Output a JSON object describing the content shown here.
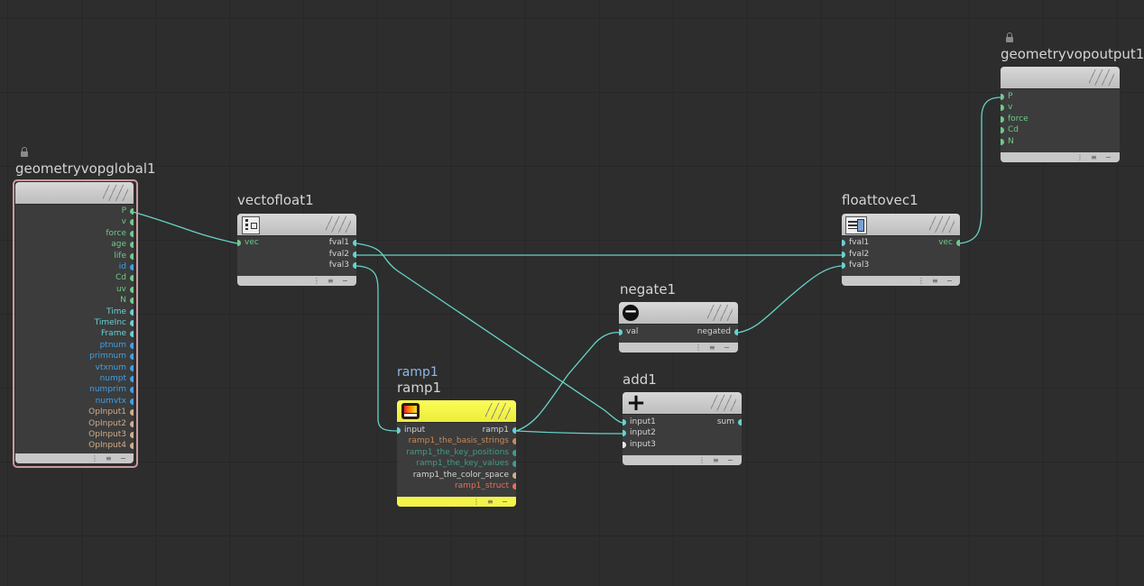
{
  "colors": {
    "background": "#2d2d2d",
    "wire": "#67d3c7",
    "port_green": "#6fc98a",
    "port_blue": "#3ea0e8",
    "port_tan": "#d1ac8a",
    "port_orange": "#c98a58",
    "port_teal": "#3c9e8c",
    "port_red": "#e0705a",
    "port_cyan": "#69d1d1",
    "port_white": "#e8e8e8",
    "ramp_yellow": "#f4f44a"
  },
  "footer_controls": [
    "⋮",
    "≡",
    "−"
  ],
  "nodes": {
    "global": {
      "title": "geometryvopglobal1",
      "icon": "lock-icon",
      "outputs": [
        {
          "label": "P",
          "color": "#6fc98a"
        },
        {
          "label": "v",
          "color": "#6fc98a"
        },
        {
          "label": "force",
          "color": "#6fc98a"
        },
        {
          "label": "age",
          "color": "#6fc98a"
        },
        {
          "label": "life",
          "color": "#6fc98a"
        },
        {
          "label": "id",
          "color": "#3ea0e8"
        },
        {
          "label": "Cd",
          "color": "#6fc98a"
        },
        {
          "label": "uv",
          "color": "#6fc98a"
        },
        {
          "label": "N",
          "color": "#6fc98a"
        },
        {
          "label": "Time",
          "color": "#69d1d1"
        },
        {
          "label": "TimeInc",
          "color": "#69d1d1"
        },
        {
          "label": "Frame",
          "color": "#69d1d1"
        },
        {
          "label": "ptnum",
          "color": "#3ea0e8"
        },
        {
          "label": "primnum",
          "color": "#3ea0e8"
        },
        {
          "label": "vtxnum",
          "color": "#3ea0e8"
        },
        {
          "label": "numpt",
          "color": "#3ea0e8"
        },
        {
          "label": "numprim",
          "color": "#3ea0e8"
        },
        {
          "label": "numvtx",
          "color": "#3ea0e8"
        },
        {
          "label": "OpInput1",
          "color": "#d1ac8a"
        },
        {
          "label": "OpInput2",
          "color": "#d1ac8a"
        },
        {
          "label": "OpInput3",
          "color": "#d1ac8a"
        },
        {
          "label": "OpInput4",
          "color": "#d1ac8a"
        }
      ]
    },
    "vectofloat": {
      "title": "vectofloat1",
      "inputs": [
        {
          "label": "vec",
          "color": "#6fc98a"
        }
      ],
      "outputs": [
        {
          "label": "fval1",
          "color": "#69d1d1"
        },
        {
          "label": "fval2",
          "color": "#69d1d1"
        },
        {
          "label": "fval3",
          "color": "#69d1d1"
        }
      ]
    },
    "floattovec": {
      "title": "floattovec1",
      "inputs": [
        {
          "label": "fval1",
          "color": "#69d1d1"
        },
        {
          "label": "fval2",
          "color": "#69d1d1"
        },
        {
          "label": "fval3",
          "color": "#69d1d1"
        }
      ],
      "outputs": [
        {
          "label": "vec",
          "color": "#6fc98a"
        }
      ]
    },
    "output": {
      "title": "geometryvopoutput1",
      "icon": "lock-icon",
      "inputs": [
        {
          "label": "P",
          "color": "#6fc98a"
        },
        {
          "label": "v",
          "color": "#6fc98a"
        },
        {
          "label": "force",
          "color": "#6fc98a"
        },
        {
          "label": "Cd",
          "color": "#6fc98a"
        },
        {
          "label": "N",
          "color": "#6fc98a"
        }
      ]
    },
    "negate": {
      "title": "negate1",
      "inputs": [
        {
          "label": "val",
          "color": "#69d1d1"
        }
      ],
      "outputs": [
        {
          "label": "negated",
          "color": "#69d1d1"
        }
      ]
    },
    "add": {
      "title": "add1",
      "inputs": [
        {
          "label": "input1",
          "color": "#69d1d1"
        },
        {
          "label": "input2",
          "color": "#69d1d1"
        },
        {
          "label": "input3",
          "color": "#e8e8e8"
        }
      ],
      "outputs": [
        {
          "label": "sum",
          "color": "#69d1d1"
        }
      ]
    },
    "ramp": {
      "subtitle": "ramp1",
      "title": "ramp1",
      "inputs": [
        {
          "label": "input",
          "color": "#69d1d1"
        }
      ],
      "outputs": [
        {
          "label": "ramp1",
          "color": "#69d1d1"
        },
        {
          "label": "ramp1_the_basis_strings",
          "color": "#c98a58"
        },
        {
          "label": "ramp1_the_key_positions",
          "color": "#3c9e8c"
        },
        {
          "label": "ramp1_the_key_values",
          "color": "#3c9e8c"
        },
        {
          "label": "ramp1_the_color_space",
          "color": "#d1ac8a"
        },
        {
          "label": "ramp1_struct",
          "color": "#e0705a"
        }
      ]
    }
  }
}
